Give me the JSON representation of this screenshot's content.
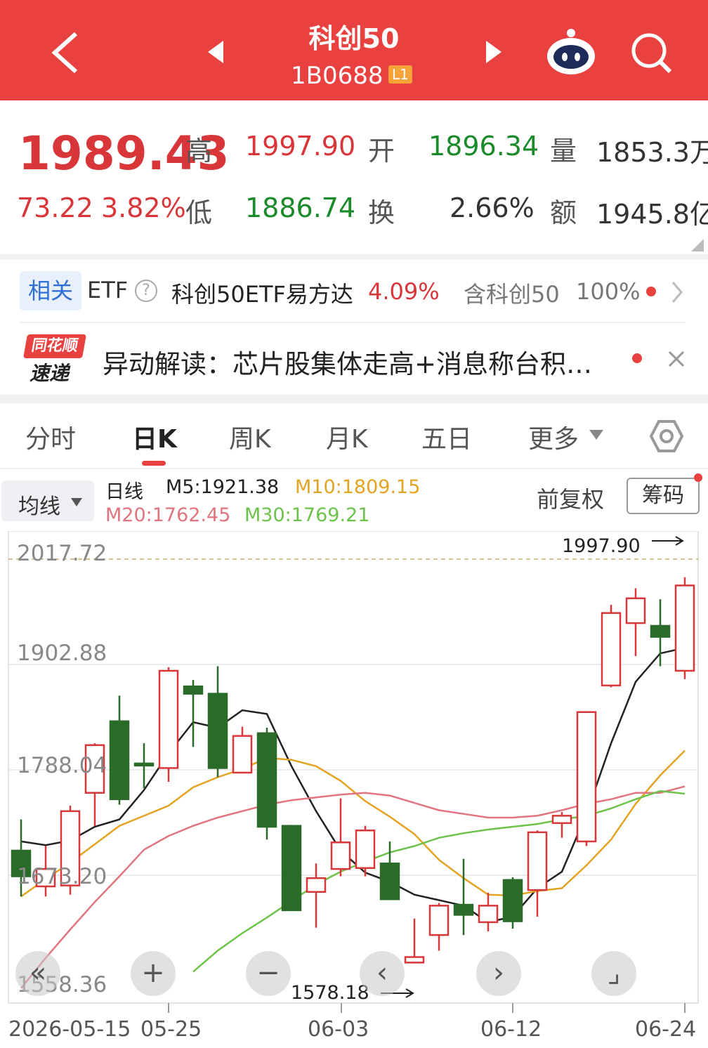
{
  "header": {
    "title": "科创50",
    "code": "1B0688",
    "level_badge": "L1",
    "icons": [
      "back-icon",
      "prev-icon",
      "next-icon",
      "robot-icon",
      "search-icon"
    ]
  },
  "quote": {
    "price": "1989.43",
    "change": "73.22",
    "change_pct": "3.82%",
    "high_label": "高",
    "high": "1997.90",
    "open_label": "开",
    "open": "1896.34",
    "volume_label": "量",
    "volume": "1853.3万",
    "low_label": "低",
    "low": "1886.74",
    "turnover_label": "换",
    "turnover": "2.66%",
    "amount_label": "额",
    "amount": "1945.8亿"
  },
  "related": {
    "tag": "相关",
    "etf_label": "ETF",
    "help": "?",
    "etf_name": "科创50ETF易方达",
    "etf_change": "4.09%",
    "contains": "含科创50",
    "contains_pct": "100%"
  },
  "news": {
    "logo_top": "同花顺",
    "logo_bottom": "速递",
    "text": "异动解读：芯片股集体走高+消息称台积…"
  },
  "tabs": [
    "分时",
    "日K",
    "周K",
    "月K",
    "五日",
    "更多"
  ],
  "active_tab": "日K",
  "indicator": {
    "dropdown": "均线",
    "label": "日线",
    "m5": "M5:1921.38",
    "m10": "M10:1809.15",
    "m20": "M20:1762.45",
    "m30": "M30:1769.21",
    "adjust": "前复权",
    "chips": "筹码"
  },
  "colors": {
    "brand_red": "#e8413f",
    "up": "#d9363a",
    "down": "#2a6b2a",
    "m5": "#222222",
    "m10": "#e3a323",
    "m20": "#e07480",
    "m30": "#6cc24a"
  },
  "chart_data": {
    "type": "candlestick",
    "y_ticks": [
      "2017.72",
      "1902.88",
      "1788.04",
      "1673.20",
      "1558.36"
    ],
    "ylim": [
      1558.36,
      2017.72
    ],
    "x_ticks": [
      "2026-05-15",
      "05-25",
      "06-03",
      "06-12",
      "06-24"
    ],
    "high_mark": "1997.90",
    "low_mark": "1578.18",
    "candles": [
      {
        "o": 1700,
        "c": 1672,
        "h": 1734,
        "l": 1650
      },
      {
        "o": 1661,
        "c": 1680,
        "h": 1705,
        "l": 1650
      },
      {
        "o": 1662,
        "c": 1743,
        "h": 1749,
        "l": 1652
      },
      {
        "o": 1763,
        "c": 1815,
        "h": 1817,
        "l": 1727
      },
      {
        "o": 1841,
        "c": 1756,
        "h": 1869,
        "l": 1750
      },
      {
        "o": 1795,
        "c": 1794,
        "h": 1817,
        "l": 1768
      },
      {
        "o": 1790,
        "c": 1896,
        "h": 1900,
        "l": 1775
      },
      {
        "o": 1879,
        "c": 1871,
        "h": 1886,
        "l": 1813
      },
      {
        "o": 1871,
        "c": 1790,
        "h": 1901,
        "l": 1780
      },
      {
        "o": 1785,
        "c": 1825,
        "h": 1835,
        "l": 1785
      },
      {
        "o": 1828,
        "c": 1726,
        "h": 1834,
        "l": 1712
      },
      {
        "o": 1727,
        "c": 1635,
        "h": 1728,
        "l": 1635
      },
      {
        "o": 1655,
        "c": 1670,
        "h": 1686,
        "l": 1616
      },
      {
        "o": 1680,
        "c": 1709,
        "h": 1757,
        "l": 1672
      },
      {
        "o": 1681,
        "c": 1722,
        "h": 1727,
        "l": 1672
      },
      {
        "o": 1686,
        "c": 1647,
        "h": 1710,
        "l": 1647
      },
      {
        "o": 1578,
        "c": 1584,
        "h": 1626,
        "l": 1578
      },
      {
        "o": 1608,
        "c": 1640,
        "h": 1643,
        "l": 1591
      },
      {
        "o": 1641,
        "c": 1630,
        "h": 1691,
        "l": 1608
      },
      {
        "o": 1622,
        "c": 1640,
        "h": 1654,
        "l": 1612
      },
      {
        "o": 1668,
        "c": 1623,
        "h": 1671,
        "l": 1615
      },
      {
        "o": 1657,
        "c": 1720,
        "h": 1722,
        "l": 1628
      },
      {
        "o": 1730,
        "c": 1738,
        "h": 1742,
        "l": 1714
      },
      {
        "o": 1710,
        "c": 1851,
        "h": 1851,
        "l": 1705
      },
      {
        "o": 1880,
        "c": 1959,
        "h": 1968,
        "l": 1878
      },
      {
        "o": 1948,
        "c": 1975,
        "h": 1986,
        "l": 1912
      },
      {
        "o": 1945,
        "c": 1933,
        "h": 1974,
        "l": 1901
      },
      {
        "o": 1896,
        "c": 1989,
        "h": 1998,
        "l": 1887
      }
    ],
    "series": [
      {
        "name": "M5",
        "values": [
          1710,
          1706,
          1711,
          1726,
          1734,
          1766,
          1806,
          1840,
          1834,
          1853,
          1849,
          1792,
          1743,
          1700,
          1676,
          1666,
          1652,
          1646,
          1640,
          1622,
          1628,
          1659,
          1677,
          1740,
          1817,
          1884,
          1915,
          1921
        ]
      },
      {
        "name": "M10",
        "values": [
          1650,
          1669,
          1687,
          1707,
          1727,
          1738,
          1749,
          1769,
          1780,
          1789,
          1801,
          1799,
          1792,
          1776,
          1754,
          1737,
          1718,
          1690,
          1670,
          1652,
          1651,
          1656,
          1659,
          1684,
          1712,
          1751,
          1782,
          1809
        ]
      },
      {
        "name": "M20",
        "values": [
          1550,
          1583,
          1614,
          1644,
          1672,
          1701,
          1716,
          1727,
          1736,
          1743,
          1750,
          1755,
          1758,
          1761,
          1763,
          1760,
          1752,
          1744,
          1740,
          1736,
          1736,
          1738,
          1744,
          1751,
          1756,
          1763,
          1763,
          1770
        ]
      },
      {
        "name": "M30",
        "values": [
          null,
          null,
          null,
          null,
          null,
          null,
          null,
          1568,
          1591,
          1610,
          1627,
          1645,
          1663,
          1677,
          1688,
          1698,
          1705,
          1714,
          1719,
          1723,
          1726,
          1729,
          1734,
          1738,
          1746,
          1756,
          1765,
          1762
        ]
      }
    ]
  },
  "chart_controls": [
    "«",
    "+",
    "−",
    "‹",
    "›",
    "⌟"
  ]
}
